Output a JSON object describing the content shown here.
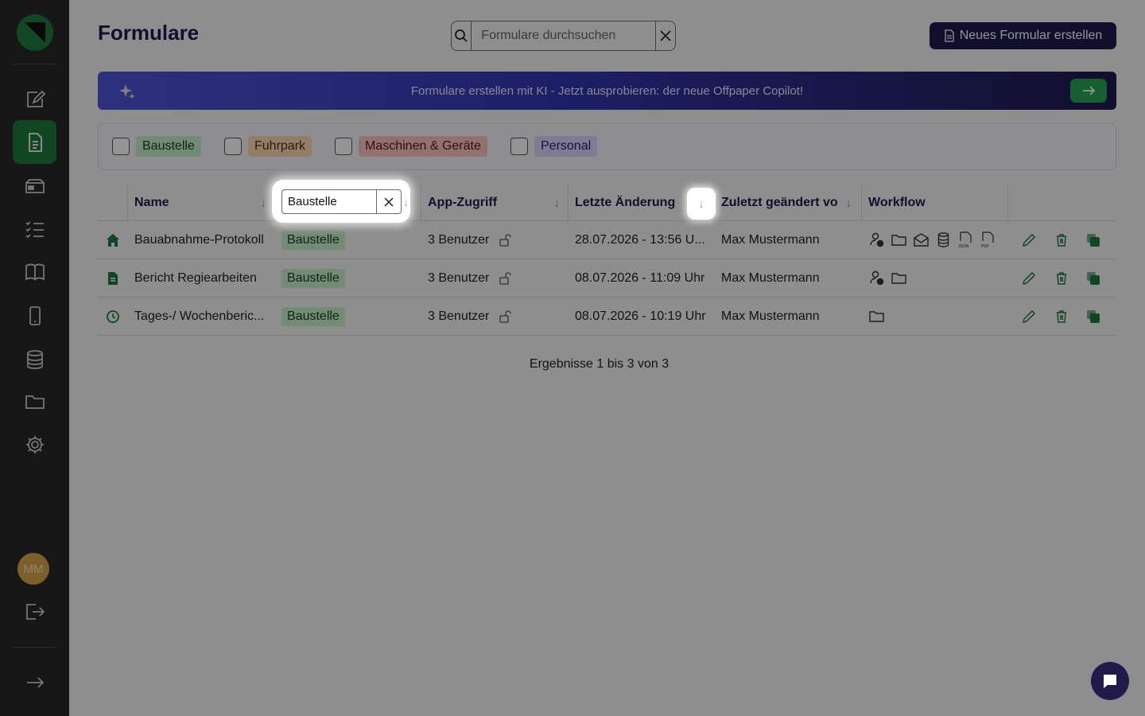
{
  "page": {
    "title": "Formulare"
  },
  "search": {
    "placeholder": "Formulare durchsuchen"
  },
  "actions": {
    "new_form_label": "Neues Formular erstellen"
  },
  "banner": {
    "text": "Formulare erstellen mit KI - Jetzt ausprobieren: der neue Offpaper Copilot!"
  },
  "filters": {
    "tags": [
      {
        "label": "Baustelle",
        "color": "#c5f0cd"
      },
      {
        "label": "Fuhrpark",
        "color": "#ffd8b0"
      },
      {
        "label": "Maschinen & Geräte",
        "color": "#ffc3c3"
      },
      {
        "label": "Personal",
        "color": "#d7d6ff"
      }
    ]
  },
  "table": {
    "columns": [
      "Name",
      "App-Zugriff",
      "Letzte Änderung",
      "Zuletzt geändert vo",
      "Workflow"
    ],
    "tag_filter_value": "Baustelle",
    "rows": [
      {
        "icon": "home-icon",
        "name": "Bauabnahme-Protokoll",
        "tag": "Baustelle",
        "access": "3 Benutzer",
        "modified": "28.07.2026 - 13:56 U...",
        "modified_by": "Max Mustermann",
        "workflow": [
          "user-check-icon",
          "folder-icon",
          "mail-icon",
          "database-icon",
          "json-file-icon",
          "pdf-file-icon"
        ]
      },
      {
        "icon": "document-icon",
        "name": "Bericht Regiearbeiten",
        "tag": "Baustelle",
        "access": "3 Benutzer",
        "modified": "08.07.2026 - 11:09 Uhr",
        "modified_by": "Max Mustermann",
        "workflow": [
          "user-check-icon",
          "folder-icon"
        ]
      },
      {
        "icon": "clock-icon",
        "name": "Tages-/ Wochenberic...",
        "tag": "Baustelle",
        "access": "3 Benutzer",
        "modified": "08.07.2026 - 10:19 Uhr",
        "modified_by": "Max Mustermann",
        "workflow": [
          "folder-icon"
        ]
      }
    ],
    "results_text": "Ergebnisse 1 bis 3 von 3"
  },
  "user": {
    "initials": "MM"
  },
  "colors": {
    "brand": "#1e1b4b",
    "accent_green": "#1d7b3c",
    "sidebar": "#282828"
  }
}
